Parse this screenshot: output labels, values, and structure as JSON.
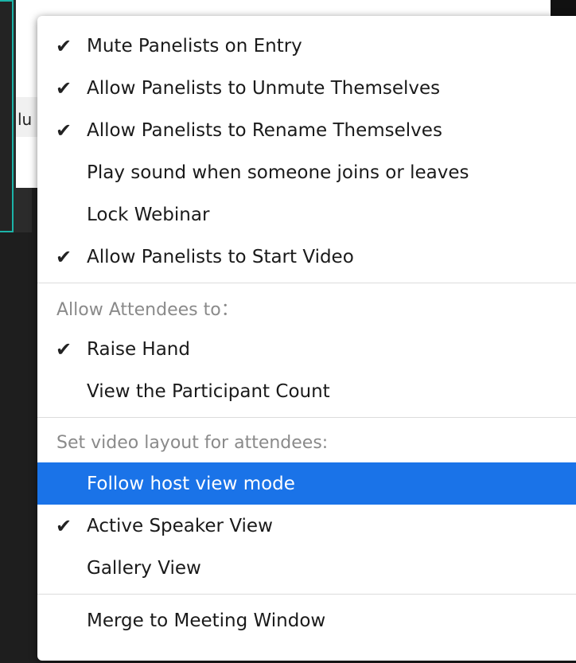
{
  "background": {
    "peek_text": "lu",
    "accent_color": "#1bb3a8"
  },
  "menu": {
    "group1": [
      {
        "label": "Mute Panelists on Entry",
        "checked": true
      },
      {
        "label": "Allow Panelists to Unmute Themselves",
        "checked": true
      },
      {
        "label": "Allow Panelists to Rename Themselves",
        "checked": true
      },
      {
        "label": "Play sound when someone joins or leaves",
        "checked": false
      },
      {
        "label": "Lock Webinar",
        "checked": false
      },
      {
        "label": "Allow Panelists to Start Video",
        "checked": true
      }
    ],
    "attendees_header": "Allow Attendees to：",
    "group2": [
      {
        "label": "Raise Hand",
        "checked": true
      },
      {
        "label": "View the Participant Count",
        "checked": false
      }
    ],
    "layout_header": "Set video layout for attendees:",
    "group3": [
      {
        "label": "Follow host view mode",
        "checked": false,
        "highlighted": true
      },
      {
        "label": "Active Speaker View",
        "checked": true
      },
      {
        "label": "Gallery View",
        "checked": false
      }
    ],
    "group4": [
      {
        "label": "Merge to Meeting Window",
        "checked": false
      }
    ],
    "check_glyph": "✔",
    "highlight_color": "#1a73e8"
  }
}
